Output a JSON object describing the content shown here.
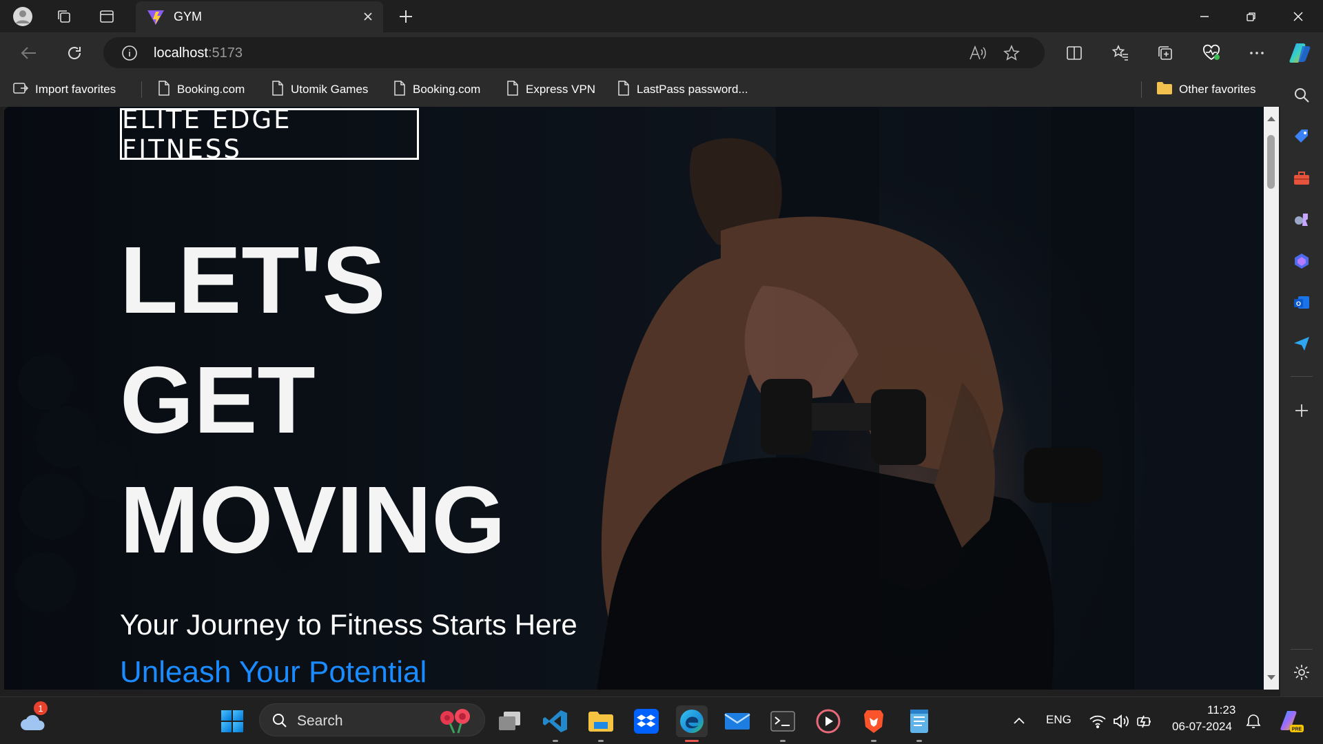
{
  "browser": {
    "tab_title": "GYM",
    "url_host": "localhost",
    "url_port": ":5173"
  },
  "favorites": {
    "items": [
      {
        "label": "Import favorites",
        "icon": "import-icon"
      },
      {
        "label": "Booking.com",
        "icon": "page-icon"
      },
      {
        "label": "Utomik Games",
        "icon": "page-icon"
      },
      {
        "label": "Booking.com",
        "icon": "page-icon"
      },
      {
        "label": "Express VPN",
        "icon": "page-icon"
      },
      {
        "label": "LastPass password...",
        "icon": "page-icon"
      }
    ],
    "other": "Other favorites"
  },
  "page": {
    "brand": "ELITE EDGE FITNESS",
    "headline": [
      "LET'S",
      "GET",
      "MOVING"
    ],
    "tagline": "Your Journey to Fitness Starts Here",
    "subtag": "Unleash Your Potential",
    "accent": "#1a8cff"
  },
  "taskbar": {
    "search_label": "Search",
    "notification_count": "1",
    "language": "ENG",
    "time": "11:23",
    "date": "06-07-2024"
  }
}
